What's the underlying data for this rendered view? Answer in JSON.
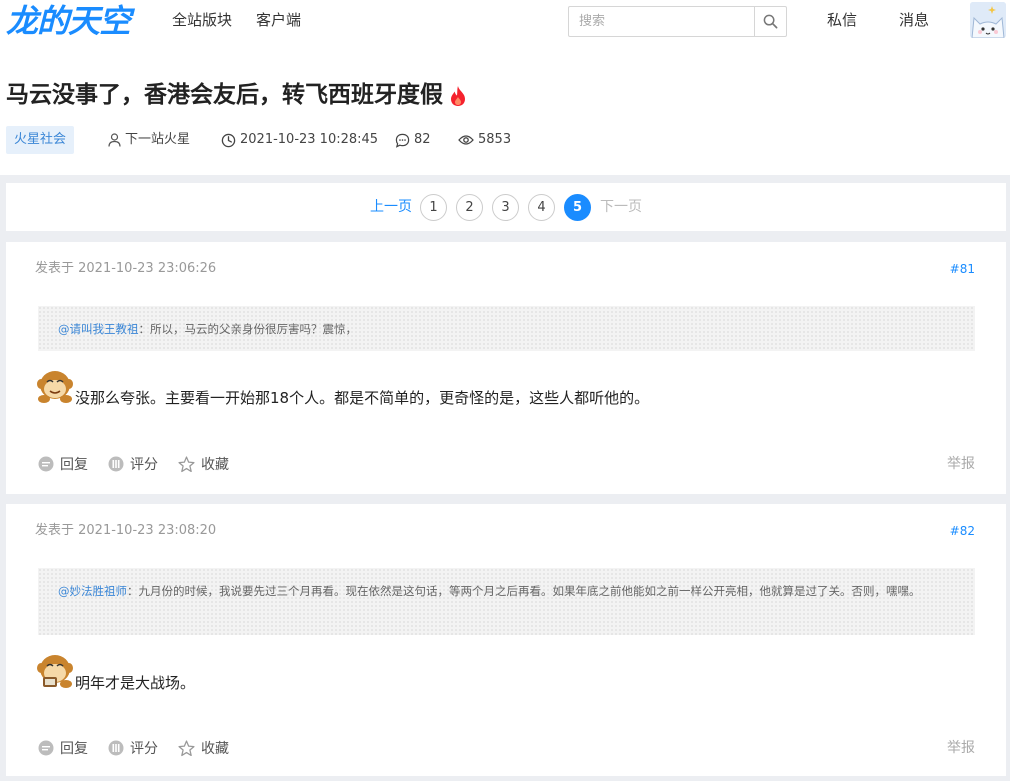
{
  "header": {
    "logo": "龙的天空",
    "nav": [
      "全站版块",
      "客户端"
    ],
    "search_placeholder": "搜索",
    "right_links": [
      "私信",
      "消息"
    ]
  },
  "post": {
    "title": "马云没事了，香港会友后，转飞西班牙度假",
    "category": "火星社会",
    "author": "下一站火星",
    "datetime": "2021-10-23 10:28:45",
    "replies": "82",
    "views": "5853"
  },
  "pagination": {
    "prev": "上一页",
    "pages": [
      "1",
      "2",
      "3",
      "4",
      "5"
    ],
    "current": "5",
    "next": "下一页"
  },
  "replies": [
    {
      "time": "发表于 2021-10-23 23:06:26",
      "floor": "#81",
      "quote_user": "@请叫我王教祖",
      "quote_text": "：所以，马云的父亲身份很厉害吗？震惊，",
      "content": "没那么夸张。主要看一开始那18个人。都是不简单的，更奇怪的是，这些人都听他的。",
      "actions": [
        "回复",
        "评分",
        "收藏"
      ],
      "report": "举报"
    },
    {
      "time": "发表于 2021-10-23 23:08:20",
      "floor": "#82",
      "quote_user": "@妙法胜祖师",
      "quote_text": "：九月份的时候，我说要先过三个月再看。现在依然是这句话，等两个月之后再看。如果年底之前他能如之前一样公开亮相，他就算是过了关。否则，嘿嘿。",
      "content": "明年才是大战场。",
      "actions": [
        "回复",
        "评分",
        "收藏"
      ],
      "report": "举报"
    }
  ],
  "colors": {
    "accent": "#1a8cff",
    "tag_bg": "#e6f0fb",
    "fire": "#f5222d"
  }
}
